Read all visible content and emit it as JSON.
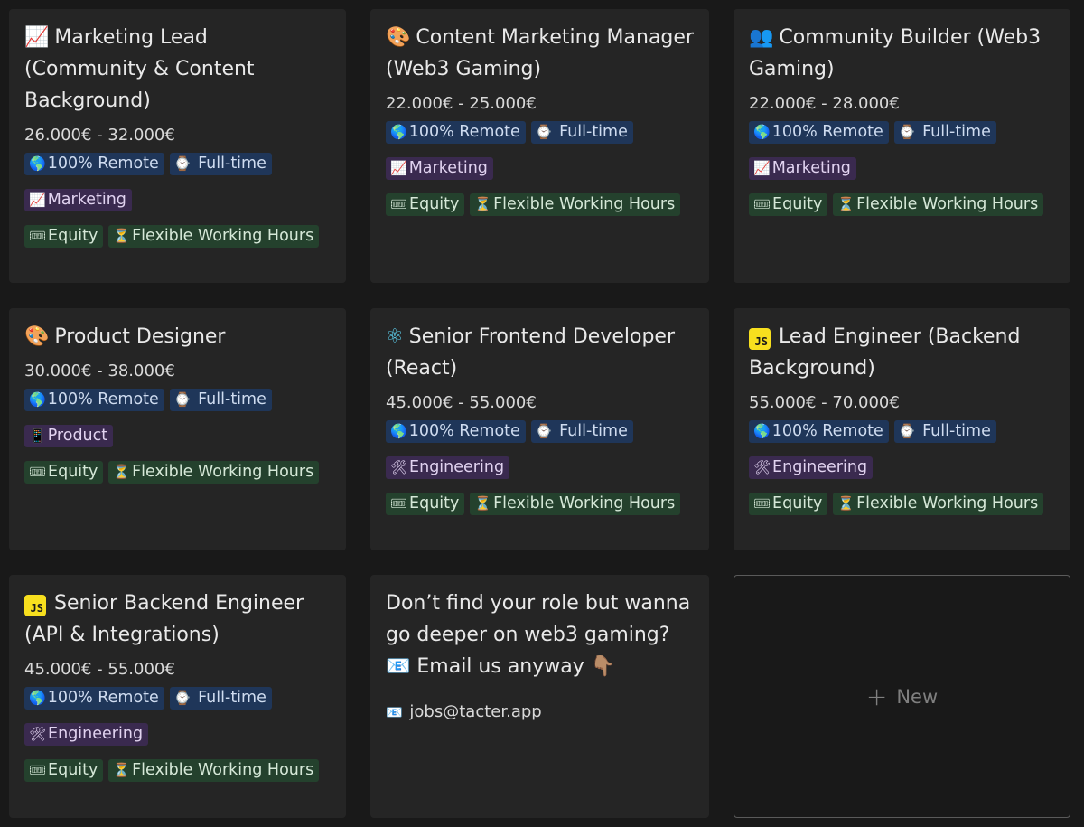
{
  "cards": [
    {
      "icon": "📈",
      "title": "Marketing Lead (Community & Content Background)",
      "salary": "26.000€ - 32.000€",
      "remote": "100% Remote",
      "time": "Full-time",
      "category_icon": "📈",
      "category": "Marketing",
      "equity": "Equity",
      "hours": "Flexible Working Hours"
    },
    {
      "icon": "🎨",
      "title": "Content Marketing Manager (Web3 Gaming)",
      "salary": "22.000€ - 25.000€",
      "remote": "100% Remote",
      "time": "Full-time",
      "category_icon": "📈",
      "category": "Marketing",
      "equity": "Equity",
      "hours": "Flexible Working Hours"
    },
    {
      "icon": "👥",
      "title": "Community Builder (Web3 Gaming)",
      "salary": "22.000€ - 28.000€",
      "remote": "100% Remote",
      "time": "Full-time",
      "category_icon": "📈",
      "category": "Marketing",
      "equity": "Equity",
      "hours": "Flexible Working Hours"
    },
    {
      "icon": "🎨",
      "title": "Product Designer",
      "salary": "30.000€ - 38.000€",
      "remote": "100% Remote",
      "time": "Full-time",
      "category_icon": "📱",
      "category": "Product",
      "equity": "Equity",
      "hours": "Flexible Working Hours"
    },
    {
      "icon": "⚛",
      "title": "Senior Frontend Developer (React)",
      "salary": "45.000€ - 55.000€",
      "remote": "100% Remote",
      "time": "Full-time",
      "category_icon": "🛠",
      "category": "Engineering",
      "equity": "Equity",
      "hours": "Flexible Working Hours"
    },
    {
      "icon": "JS",
      "title": "Lead Engineer (Backend Background)",
      "salary": "55.000€ - 70.000€",
      "remote": "100% Remote",
      "time": "Full-time",
      "category_icon": "🛠",
      "category": "Engineering",
      "equity": "Equity",
      "hours": "Flexible Working Hours"
    },
    {
      "icon": "JS",
      "title": "Senior Backend Engineer (API & Integrations)",
      "salary": "45.000€ - 55.000€",
      "remote": "100% Remote",
      "time": "Full-time",
      "category_icon": "🛠",
      "category": "Engineering",
      "equity": "Equity",
      "hours": "Flexible Working Hours"
    }
  ],
  "tag_icons": {
    "remote": "🌎",
    "time": "⌚",
    "equity": "🎟",
    "hours": "⏳"
  },
  "note_card": {
    "text": "Don’t find your role but wanna go deeper on web3 gaming? 📧 Email us anyway 👇🏽",
    "email_icon": "📧",
    "email": "jobs@tacter.app"
  },
  "new_card": {
    "plus": "+",
    "label": "New"
  },
  "colors": {
    "background": "#191919",
    "card": "#252525",
    "tag_blue": "#1f3659",
    "tag_purple": "#3a2a4f",
    "tag_green": "#24412d",
    "js_yellow": "#f7df1e"
  }
}
